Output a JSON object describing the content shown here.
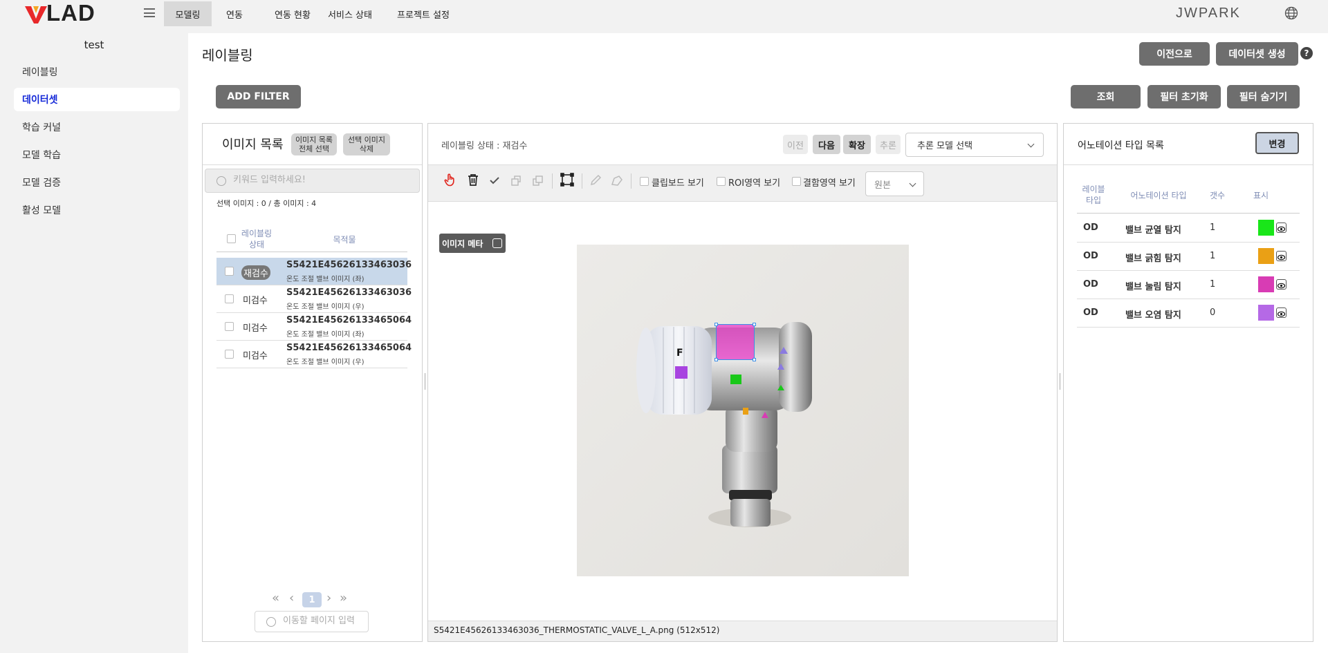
{
  "header": {
    "logo": "VLAD",
    "nav": [
      "모델링",
      "연동",
      "연동 현황",
      "서비스 상태",
      "프로젝트 설정"
    ],
    "user": "JWPARK"
  },
  "sidebar": {
    "project": "test",
    "items": [
      "레이블링",
      "데이터셋",
      "학습 커널",
      "모델 학습",
      "모델 검증",
      "활성 모델"
    ],
    "active": "데이터셋"
  },
  "page": {
    "title": "레이블링",
    "back_button": "이전으로",
    "create_dataset_button": "데이터셋 생성",
    "help": "?",
    "add_filter": "ADD FILTER",
    "search_button": "조회",
    "reset_filter": "필터 초기화",
    "hide_filter": "필터 숨기기"
  },
  "image_list": {
    "title": "이미지 목록",
    "select_all_line1": "이미지 목록",
    "select_all_line2": "전체 선택",
    "delete_line1": "선택 이미지",
    "delete_line2": "삭제",
    "search_placeholder": "키워드 입력하세요!",
    "count_text": "선택 이미지 : 0 / 총 이미지 : 4",
    "col_status_line1": "레이블링",
    "col_status_line2": "상태",
    "col_target": "목적물",
    "rows": [
      {
        "status": "재검수",
        "file": "S5421E45626133463036",
        "desc": "온도 조절 밸브 이미지 (좌)"
      },
      {
        "status": "미검수",
        "file": "S5421E45626133463036",
        "desc": "온도 조절 밸브 이미지 (우)"
      },
      {
        "status": "미검수",
        "file": "S5421E45626133465064",
        "desc": "온도 조절 밸브 이미지 (좌)"
      },
      {
        "status": "미검수",
        "file": "S5421E45626133465064",
        "desc": "온도 조절 밸브 이미지 (우)"
      }
    ],
    "page": "1",
    "page_input_placeholder": "이동할 페이지 입력"
  },
  "canvas": {
    "status_text": "레이블링 상태 : 재검수",
    "prev": "이전",
    "next": "다음",
    "expand": "확장",
    "infer": "추론",
    "model_select": "추론 모델 선택",
    "clipboard_label": "클립보드 보기",
    "roi_label": "ROI영역 보기",
    "defect_label": "결함영역 보기",
    "view_select": "원본",
    "image_meta": "이미지 메타",
    "annotation_letter": "F",
    "footer": "S5421E45626133463036_THERMOSTATIC_VALVE_L_A.png (512x512)"
  },
  "annotations": {
    "title": "어노테이션 타입 목록",
    "change_button": "변경",
    "col_type_line1": "레이블",
    "col_type_line2": "타입",
    "col_name": "어노테이션 타입",
    "col_count": "갯수",
    "col_show": "표시",
    "rows": [
      {
        "type": "OD",
        "name": "밸브 균열 탐지",
        "count": "1",
        "color": "#19e619"
      },
      {
        "type": "OD",
        "name": "밸브 긁힘 탐지",
        "count": "1",
        "color": "#eaa015"
      },
      {
        "type": "OD",
        "name": "밸브 눌림 탐지",
        "count": "1",
        "color": "#d83cb4"
      },
      {
        "type": "OD",
        "name": "밸브 오염 탐지",
        "count": "0",
        "color": "#b569e6"
      }
    ]
  }
}
